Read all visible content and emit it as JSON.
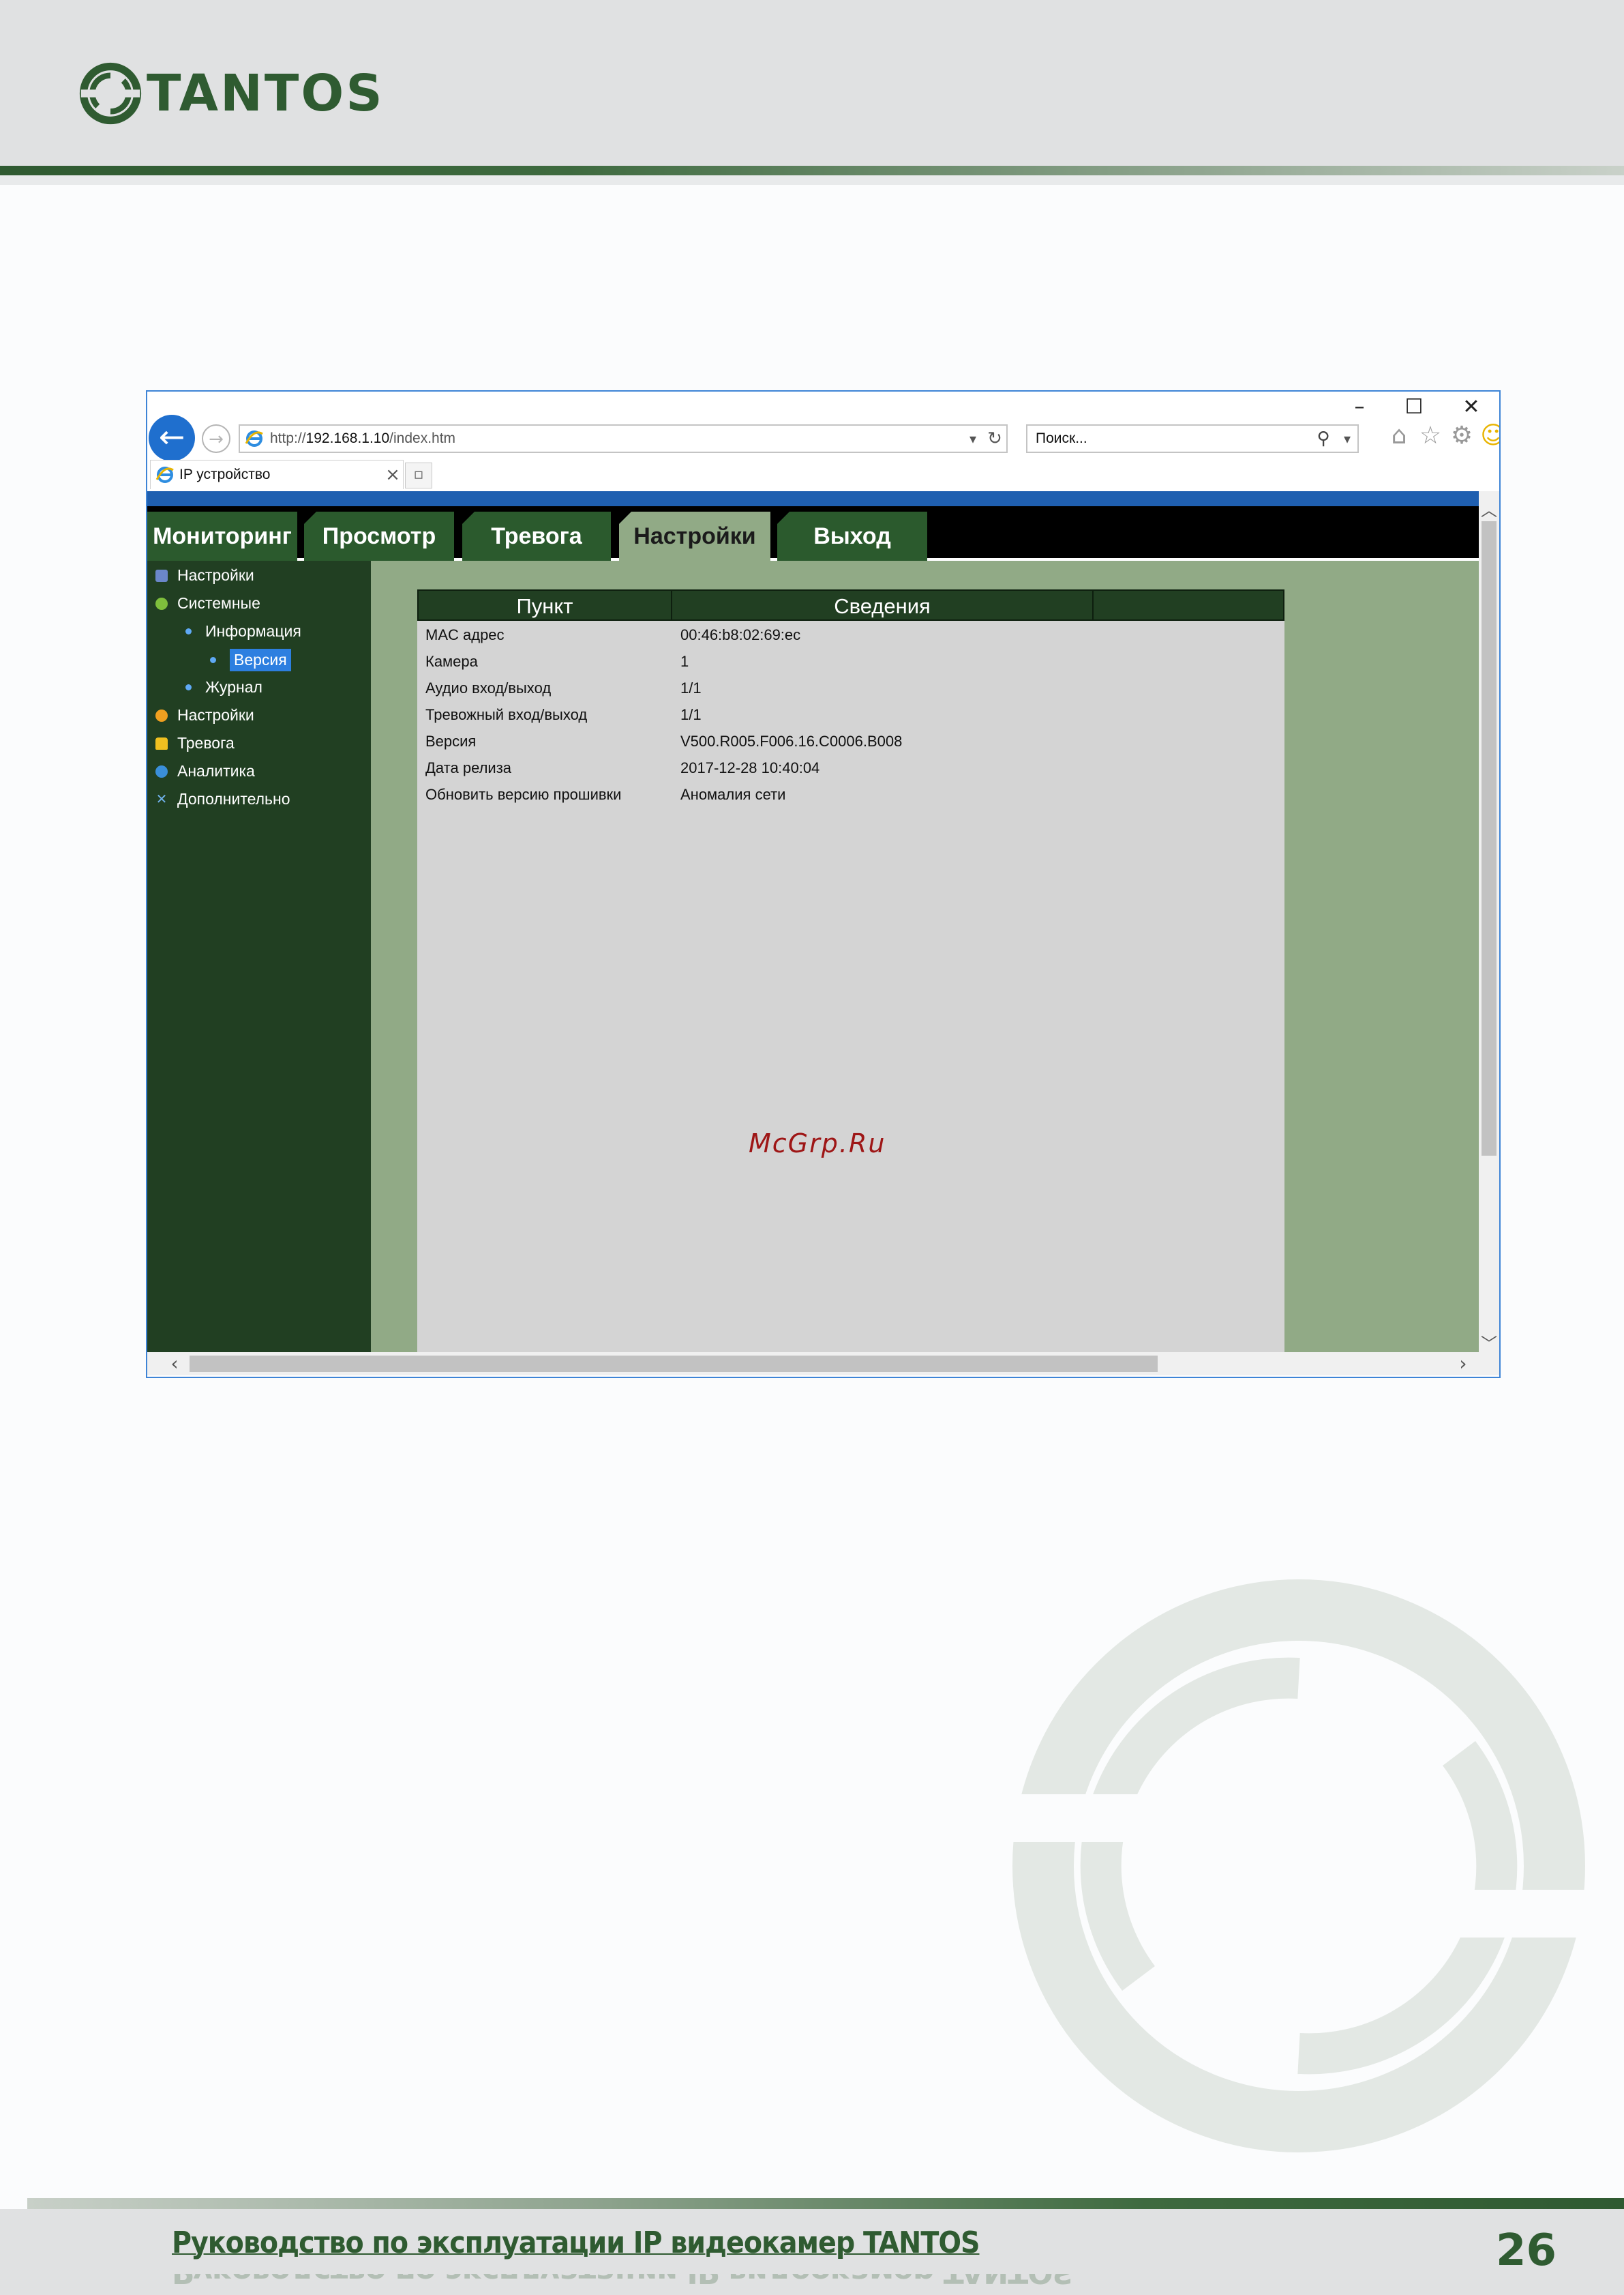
{
  "header": {
    "logo_text": "TANTOS"
  },
  "browser": {
    "address": {
      "prefix": "http://",
      "host": "192.168.1.10",
      "path": "/index.htm"
    },
    "search_placeholder": "Поиск...",
    "tab_title": "IP устройство"
  },
  "app": {
    "main_tabs": [
      {
        "label": "Мониторинг"
      },
      {
        "label": "Просмотр"
      },
      {
        "label": "Тревога"
      },
      {
        "label": "Настройки",
        "active": true
      },
      {
        "label": "Выход"
      }
    ],
    "tree": [
      {
        "label": "Настройки",
        "icon": "settings-page-icon",
        "level": 0
      },
      {
        "label": "Системные",
        "icon": "info-icon",
        "level": 0
      },
      {
        "label": "Информация",
        "icon": "bullet",
        "level": 1
      },
      {
        "label": "Версия",
        "icon": "bullet",
        "level": 2,
        "selected": true
      },
      {
        "label": "Журнал",
        "icon": "bullet",
        "level": 1
      },
      {
        "label": "Настройки",
        "icon": "gear-icon",
        "level": 0
      },
      {
        "label": "Тревога",
        "icon": "bell-icon",
        "level": 0
      },
      {
        "label": "Аналитика",
        "icon": "analytics-icon",
        "level": 0
      },
      {
        "label": "Дополнительно",
        "icon": "tools-icon",
        "level": 0
      }
    ],
    "table": {
      "headers": [
        "Пункт",
        "Сведения"
      ],
      "rows": [
        [
          "MAC адрес",
          "00:46:b8:02:69:ec"
        ],
        [
          "Камера",
          "1"
        ],
        [
          "Аудио вход/выход",
          "1/1"
        ],
        [
          "Тревожный вход/выход",
          "1/1"
        ],
        [
          "Версия",
          "V500.R005.F006.16.C0006.B008"
        ],
        [
          "Дата релиза",
          "2017-12-28 10:40:04"
        ],
        [
          "Обновить версию прошивки",
          "Аномалия сети"
        ]
      ]
    }
  },
  "watermark": "McGrp.Ru",
  "footer": {
    "title": "Руководство по эксплуатации IP видеокамер TANTOS",
    "page_number": "26"
  },
  "colors": {
    "brand_green": "#2f5b31",
    "panel_green": "#213f22",
    "content_green": "#91aa86",
    "accent_blue": "#1f6fce"
  }
}
